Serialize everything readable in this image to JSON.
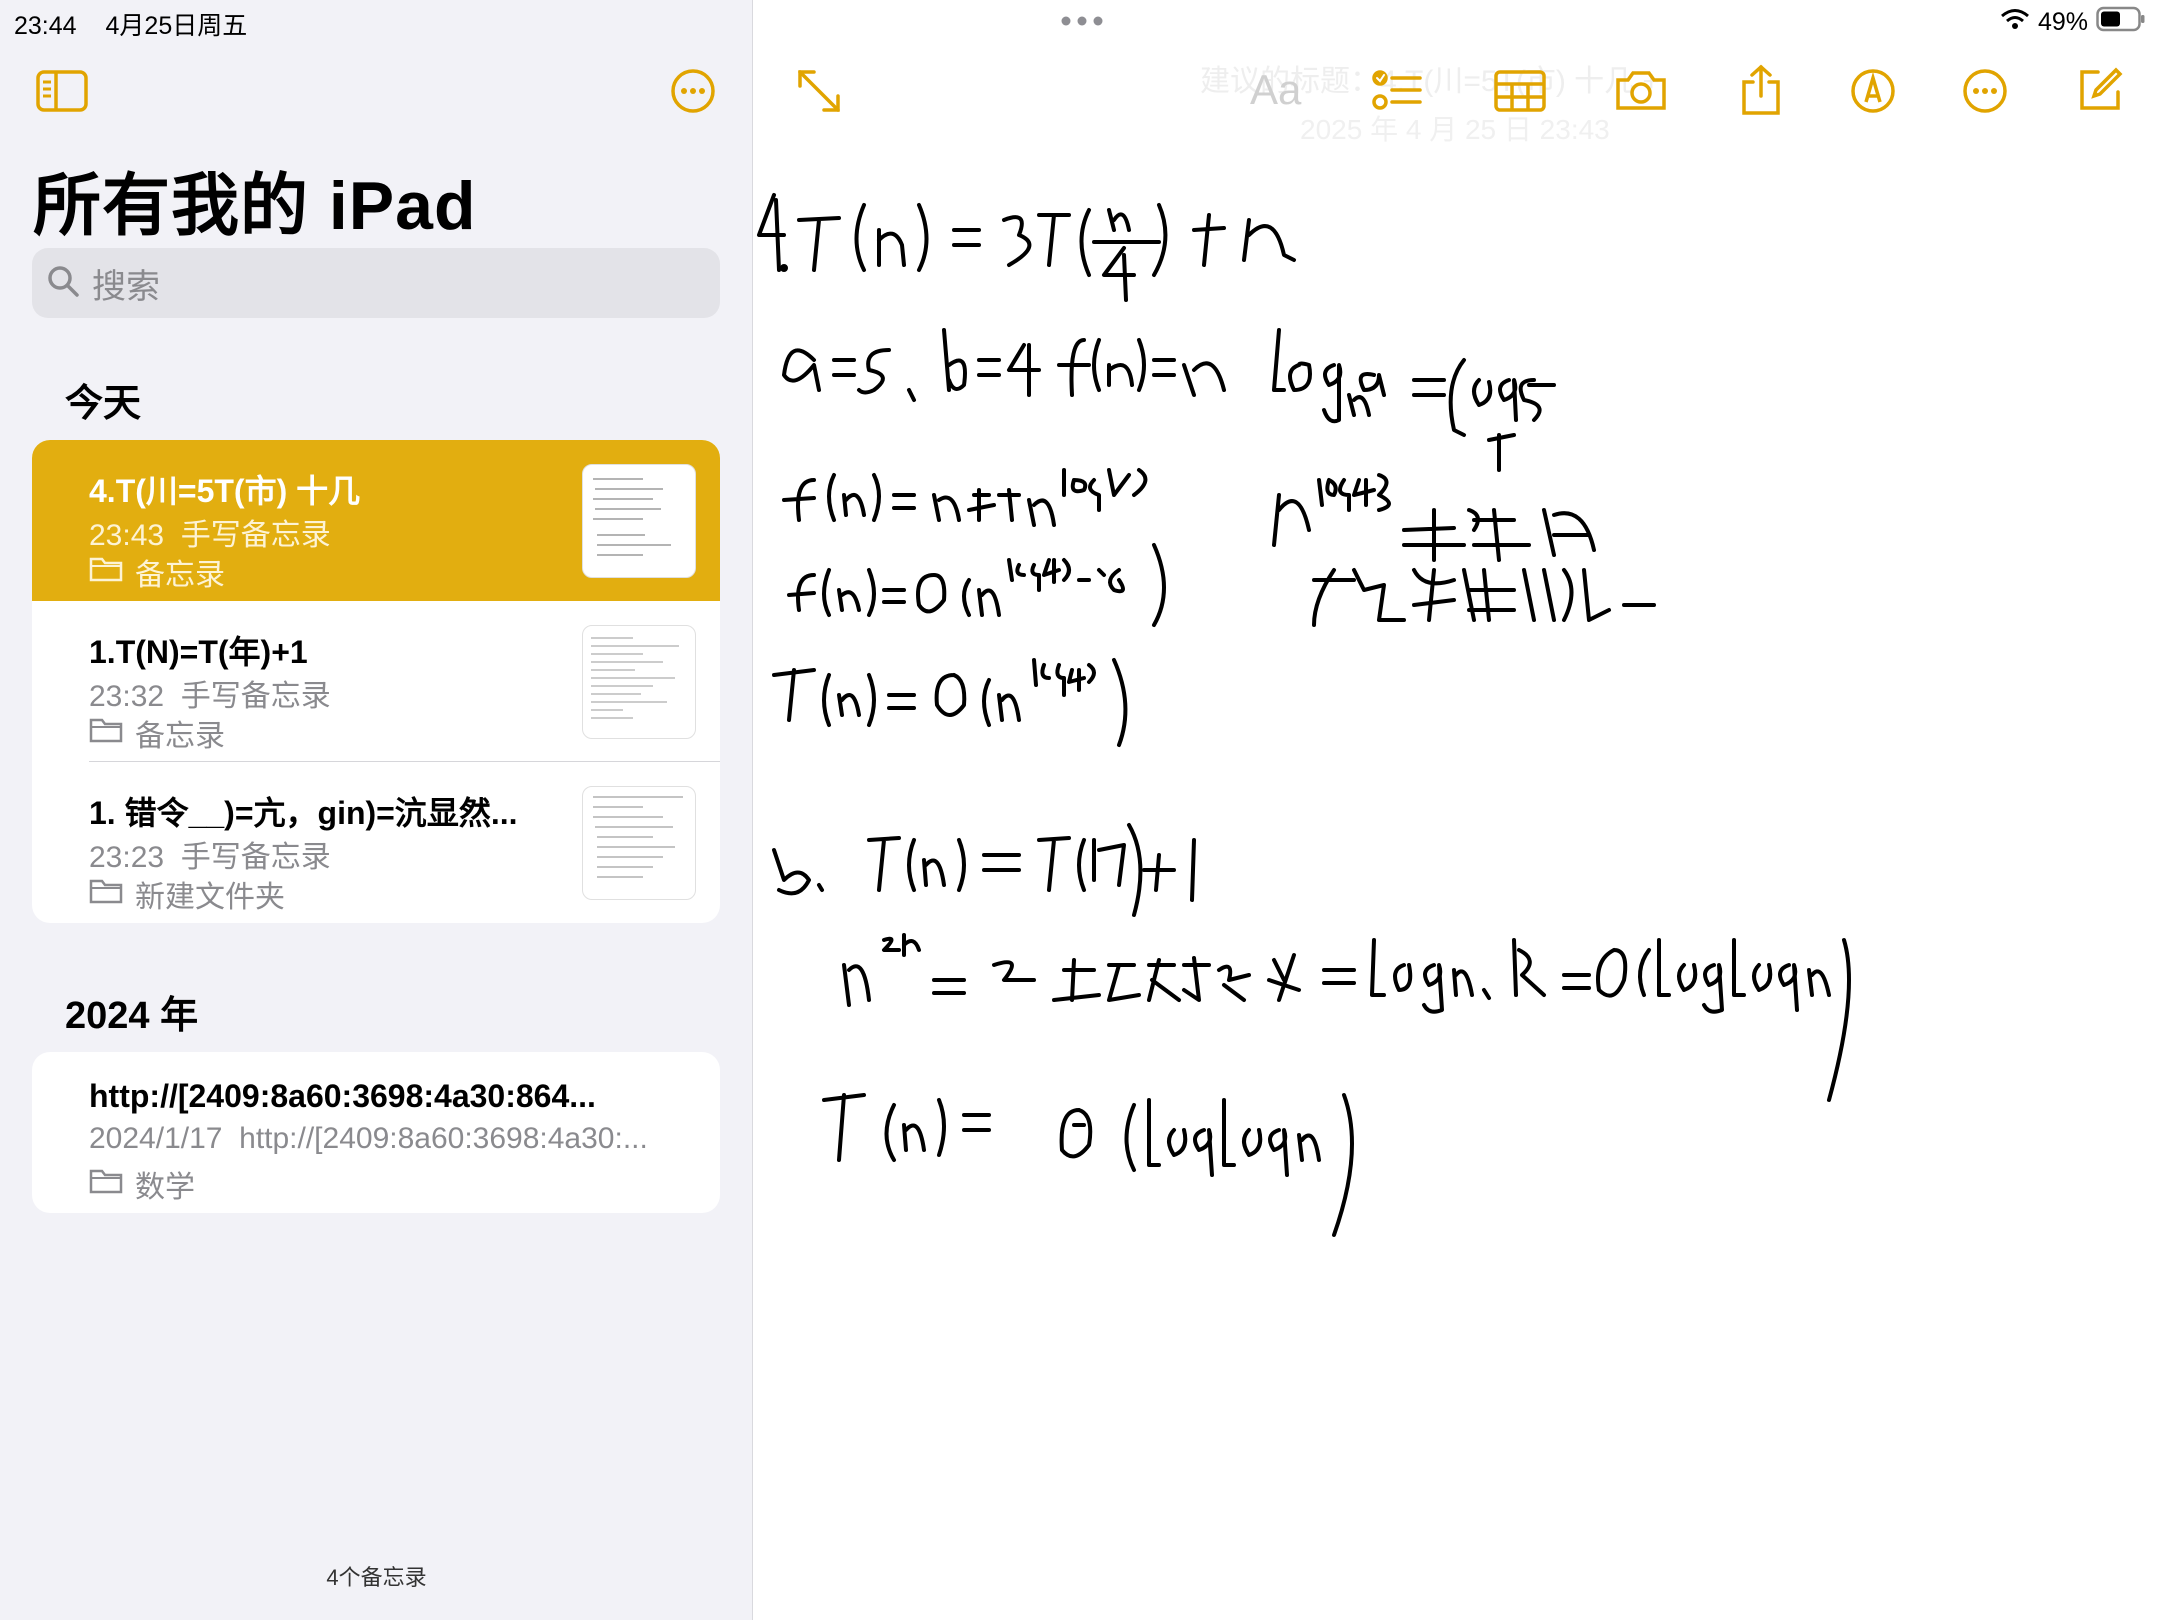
{
  "status": {
    "time": "23:44",
    "date": "4月25日周五",
    "battery": "49%"
  },
  "sidebar": {
    "title": "所有我的 iPad",
    "search_placeholder": "搜索",
    "sections": [
      {
        "header": "今天",
        "notes": [
          {
            "title": "4.T(川=5T(市) 十几",
            "time": "23:43",
            "kind": "手写备忘录",
            "folder": "备忘录"
          },
          {
            "title": "1.T(N)=T(年)+1",
            "time": "23:32",
            "kind": "手写备忘录",
            "folder": "备忘录"
          },
          {
            "title": "1. 错令__)=亢，gin)=沆显然...",
            "time": "23:23",
            "kind": "手写备忘录",
            "folder": "新建文件夹"
          }
        ]
      },
      {
        "header": "2024 年",
        "notes": [
          {
            "title": "http://[2409:8a60:3698:4a30:864...",
            "time": "2024/1/17",
            "kind": "http://[2409:8a60:3698:4a30:...",
            "folder": "数学"
          }
        ]
      }
    ],
    "count": "4个备忘录"
  },
  "editor": {
    "toolbar_format": "Aa",
    "ghost_title": "建议的标题：4.T(川=5T(市) 十几 +",
    "ghost_date": "2025 年 4 月 25 日 23:43"
  },
  "colors": {
    "accent": "#E2AE10",
    "sidebar_bg": "#F2F2F7",
    "selected_row": "#E2AE10"
  },
  "icons": [
    "sidebar-toggle-icon",
    "more-icon",
    "expand-icon",
    "checklist-icon",
    "table-icon",
    "camera-icon",
    "share-icon",
    "markup-icon",
    "compose-icon",
    "search-icon",
    "folder-icon",
    "wifi-icon",
    "battery-icon"
  ]
}
